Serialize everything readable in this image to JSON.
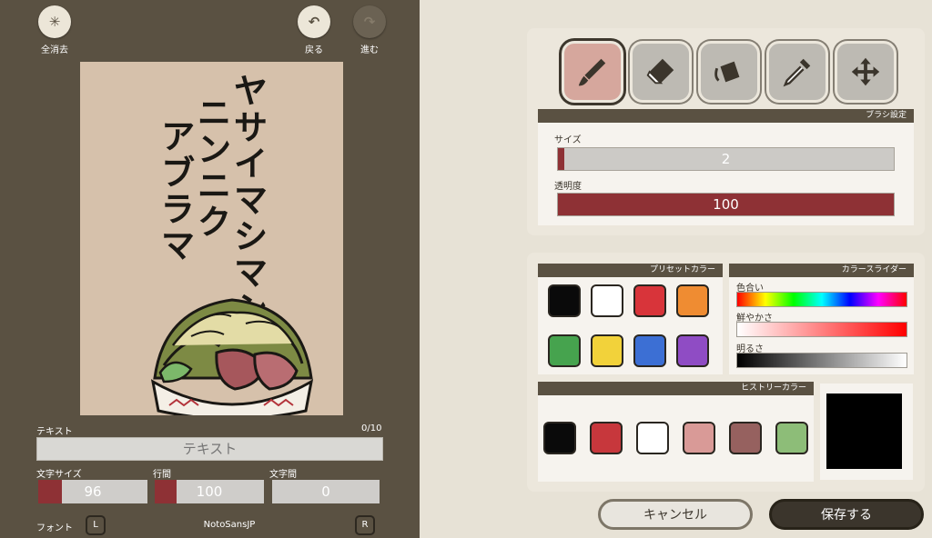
{
  "toolbar": {
    "clear_all": "全消去",
    "undo": "戻る",
    "redo": "進む"
  },
  "canvas": {
    "column1": "ヤサイマシマシ",
    "column2": "ニンニク",
    "column3": "アブラマ"
  },
  "text_panel": {
    "label": "テキスト",
    "counter": "0/10",
    "placeholder": "テキスト",
    "font_size_label": "文字サイズ",
    "font_size_value": "96",
    "font_size_fill": 0.22,
    "line_spacing_label": "行間",
    "line_spacing_value": "100",
    "line_spacing_fill": 0.2,
    "letter_spacing_label": "文字間",
    "letter_spacing_value": "0",
    "letter_spacing_fill": 0,
    "font_label": "フォント",
    "font_name": "NotoSansJP",
    "prev_key": "L",
    "next_key": "R"
  },
  "tools": {
    "items": [
      "brush",
      "eraser",
      "bucket",
      "eyedropper",
      "move"
    ],
    "active": "brush"
  },
  "brush_settings": {
    "title": "ブラシ設定",
    "size_label": "サイズ",
    "size_value": "2",
    "size_fill": 0.01,
    "opacity_label": "透明度",
    "opacity_value": "100",
    "opacity_fill": 1.0
  },
  "preset_colors": {
    "title": "プリセットカラー",
    "colors": [
      "#0a0a0a",
      "#ffffff",
      "#d8343a",
      "#ef8c32",
      "#46a34e",
      "#f2d23a",
      "#3c6fd4",
      "#8f4cc4"
    ]
  },
  "color_slider": {
    "title": "カラースライダー",
    "hue_label": "色合い",
    "saturation_label": "鮮やかさ",
    "brightness_label": "明るさ"
  },
  "history_colors": {
    "title": "ヒストリーカラー",
    "colors": [
      "#0a0a0a",
      "#c7373c",
      "#ffffff",
      "#d99a97",
      "#96615f",
      "#8dbd78"
    ],
    "current_color": "#000000"
  },
  "actions": {
    "cancel": "キャンセル",
    "save": "保存する"
  },
  "colors": {
    "accent": "#8e3135",
    "left_bg": "#5a5142",
    "canvas_bg": "#d6c1ab"
  }
}
